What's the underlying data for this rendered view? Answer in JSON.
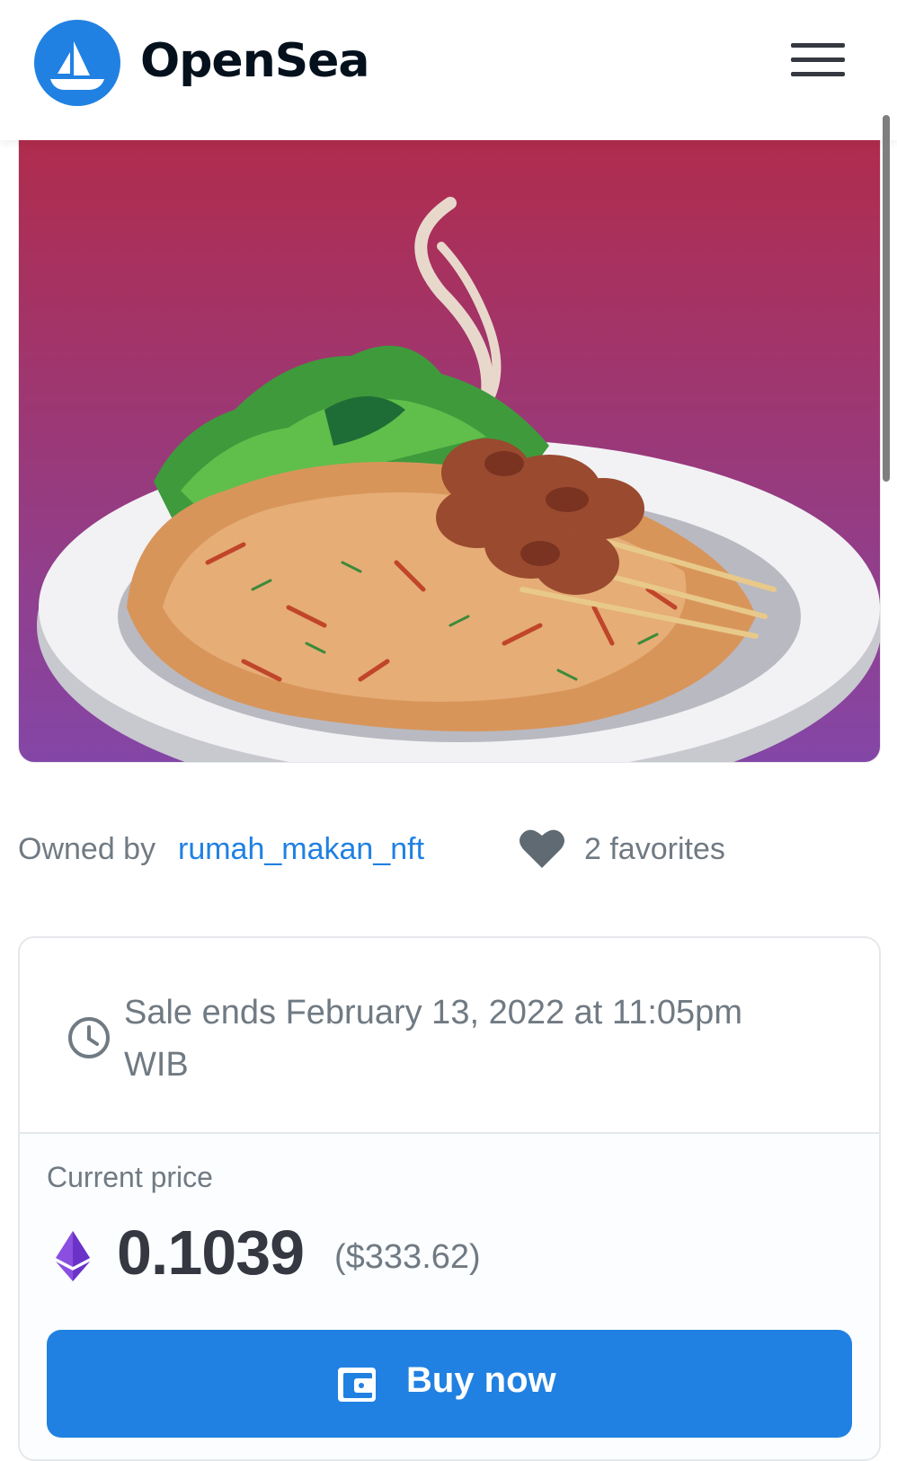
{
  "header": {
    "brand": "OpenSea",
    "logo_icon": "opensea-ship-icon",
    "menu_icon": "hamburger-menu-icon",
    "brand_color": "#2081e2"
  },
  "item": {
    "image_description_icon": "nft-artwork",
    "owned_by_label": "Owned by",
    "owner": "rumah_makan_nft",
    "favorites_text": "2 favorites",
    "favorites_icon": "heart-icon"
  },
  "sale": {
    "clock_icon": "clock-icon",
    "ends_text": "Sale ends February 13, 2022 at 11:05pm WIB"
  },
  "price": {
    "label": "Current price",
    "currency_icon": "ethereum-icon",
    "value": "0.1039",
    "usd": "($333.62)"
  },
  "buy": {
    "label": "Buy now",
    "icon": "wallet-icon",
    "color": "#2081e2"
  }
}
